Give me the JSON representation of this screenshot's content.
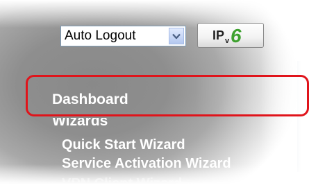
{
  "toolbar": {
    "logout_select": {
      "value": "Auto Logout"
    },
    "ipv6_button": {
      "label_ip": "IP",
      "label_v": "v",
      "label_6": "6"
    }
  },
  "menu": {
    "dashboard": "Dashboard",
    "wizards": "Wizards",
    "items": [
      "Quick Start Wizard",
      "Service Activation Wizard",
      "VPN Client Wizard"
    ]
  },
  "colors": {
    "highlight": "#e0141b",
    "ipv6_six": "#3ea12f",
    "menu_text": "#ffffff"
  }
}
